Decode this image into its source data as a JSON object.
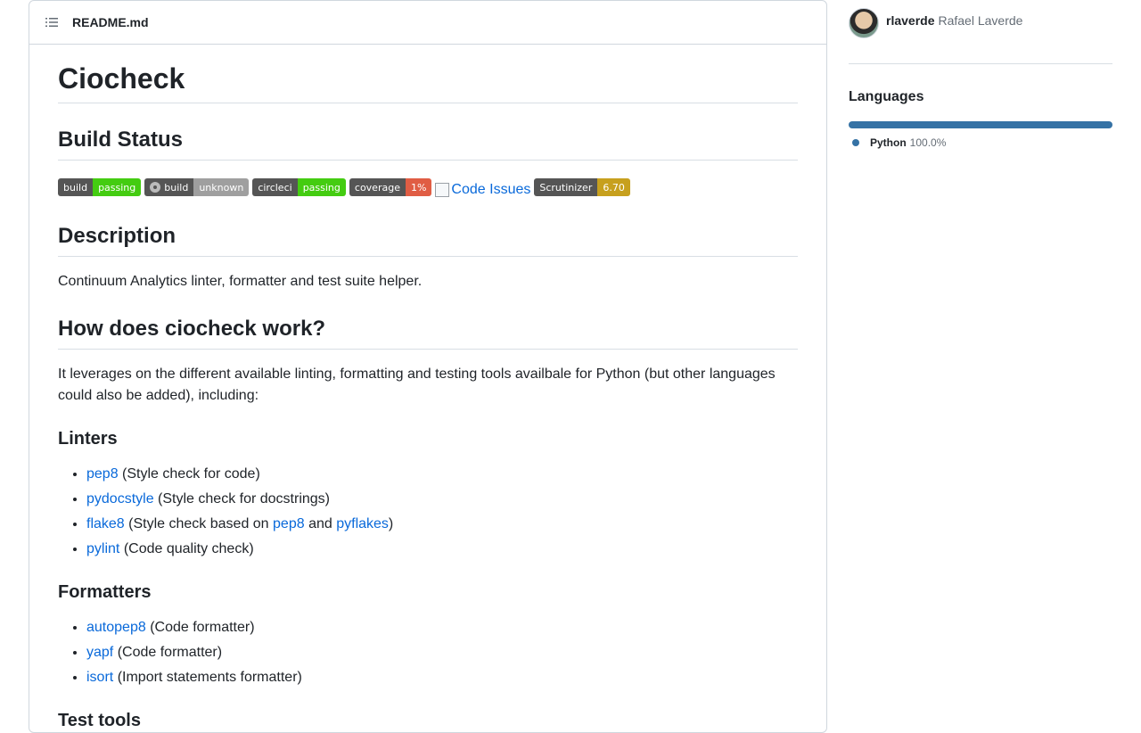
{
  "readme": {
    "filename": "README.md",
    "title": "Ciocheck",
    "build_status_heading": "Build Status",
    "badges": [
      {
        "left": "build",
        "right": "passing"
      },
      {
        "left": "build",
        "right": "unknown"
      },
      {
        "left": "circleci",
        "right": "passing"
      },
      {
        "left": "coverage",
        "right": "1%"
      },
      {
        "alt": "Code Issues"
      },
      {
        "left": "Scrutinizer",
        "right": "6.70"
      }
    ],
    "description_heading": "Description",
    "description_text": "Continuum Analytics linter, formatter and test suite helper.",
    "how_heading": "How does ciocheck work?",
    "how_text": "It leverages on the different available linting, formatting and testing tools availbale for Python (but other languages could also be added), including:",
    "linters_heading": "Linters",
    "linters": [
      {
        "name": "pep8",
        "desc": "(Style check for code)"
      },
      {
        "name": "pydocstyle",
        "desc": "(Style check for docstrings)"
      },
      {
        "name": "flake8",
        "desc_pre": "(Style check based on ",
        "link1": "pep8",
        "mid": " and ",
        "link2": "pyflakes",
        "desc_post": ")"
      },
      {
        "name": "pylint",
        "desc": "(Code quality check)"
      }
    ],
    "formatters_heading": "Formatters",
    "formatters": [
      {
        "name": "autopep8",
        "desc": "(Code formatter)"
      },
      {
        "name": "yapf",
        "desc": "(Code formatter)"
      },
      {
        "name": "isort",
        "desc": "(Import statements formatter)"
      }
    ],
    "next_heading": "Test tools"
  },
  "sidebar": {
    "owner_login": "rlaverde",
    "owner_name": "Rafael Laverde",
    "languages_heading": "Languages",
    "languages": [
      {
        "name": "Python",
        "percent": "100.0%",
        "share": 1.0,
        "color": "#3572A5"
      }
    ]
  }
}
